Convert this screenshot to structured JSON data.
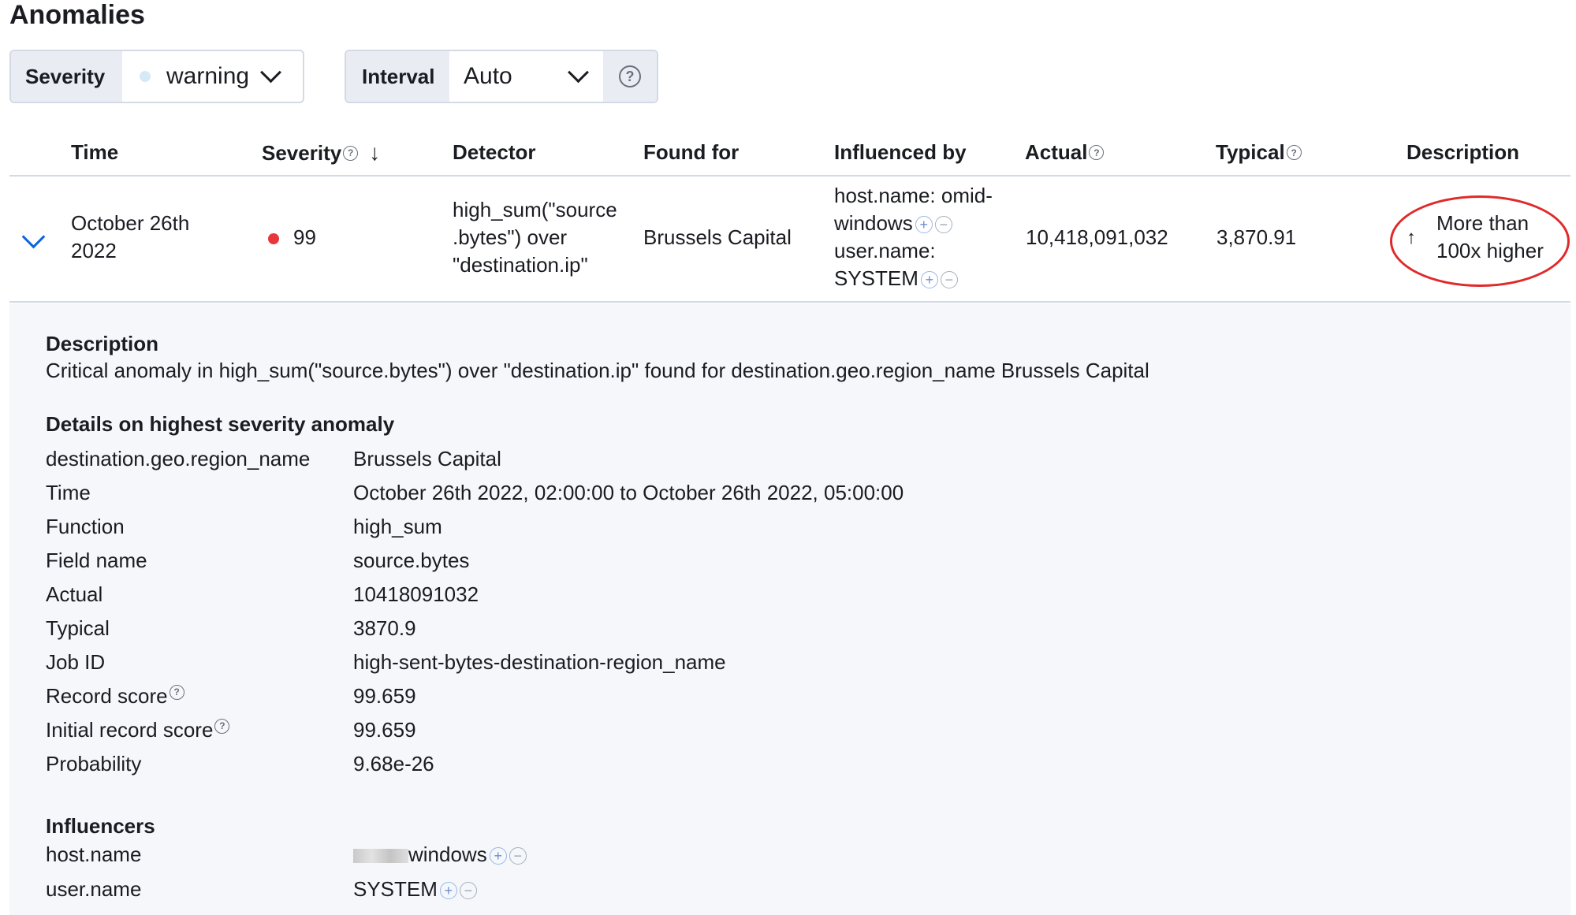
{
  "title": "Anomalies",
  "filters": {
    "severity_label": "Severity",
    "severity_value": "warning",
    "interval_label": "Interval",
    "interval_value": "Auto"
  },
  "table": {
    "headers": {
      "time": "Time",
      "severity": "Severity",
      "detector": "Detector",
      "found_for": "Found for",
      "influenced_by": "Influenced by",
      "actual": "Actual",
      "typical": "Typical",
      "description": "Description"
    },
    "row": {
      "time_line1": "October 26th",
      "time_line2": "2022",
      "severity": "99",
      "detector_line1": "high_sum(\"source",
      "detector_line2": ".bytes\") over",
      "detector_line3": "\"destination.ip\"",
      "found_for": "Brussels Capital",
      "influencer1_line1": "host.name: omid-",
      "influencer1_line2": "windows",
      "influencer2_line1": "user.name:",
      "influencer2_line2": "SYSTEM",
      "actual": "10,418,091,032",
      "typical": "3,870.91",
      "description_line1": "More than",
      "description_line2": "100x higher"
    }
  },
  "details": {
    "description_title": "Description",
    "description_text": "Critical anomaly in high_sum(\"source.bytes\") over \"destination.ip\" found for destination.geo.region_name Brussels Capital",
    "highest_title": "Details on highest severity anomaly",
    "fields": [
      {
        "label": "destination.geo.region_name",
        "value": "Brussels Capital"
      },
      {
        "label": "Time",
        "value": "October 26th 2022, 02:00:00 to October 26th 2022, 05:00:00"
      },
      {
        "label": "Function",
        "value": "high_sum"
      },
      {
        "label": "Field name",
        "value": "source.bytes"
      },
      {
        "label": "Actual",
        "value": "10418091032"
      },
      {
        "label": "Typical",
        "value": "3870.9"
      },
      {
        "label": "Job ID",
        "value": "high-sent-bytes-destination-region_name"
      },
      {
        "label": "Record score",
        "value": "99.659"
      },
      {
        "label": "Initial record score",
        "value": "99.659"
      },
      {
        "label": "Probability",
        "value": "9.68e-26"
      }
    ],
    "influencers_title": "Influencers",
    "influencers": [
      {
        "label": "host.name",
        "value": "windows"
      },
      {
        "label": "user.name",
        "value": "SYSTEM"
      }
    ]
  },
  "colors": {
    "severity_critical": "#e7373c",
    "severity_warning": "#d6e9f7",
    "annotation": "#e02a2a",
    "accent": "#0b64dd"
  }
}
